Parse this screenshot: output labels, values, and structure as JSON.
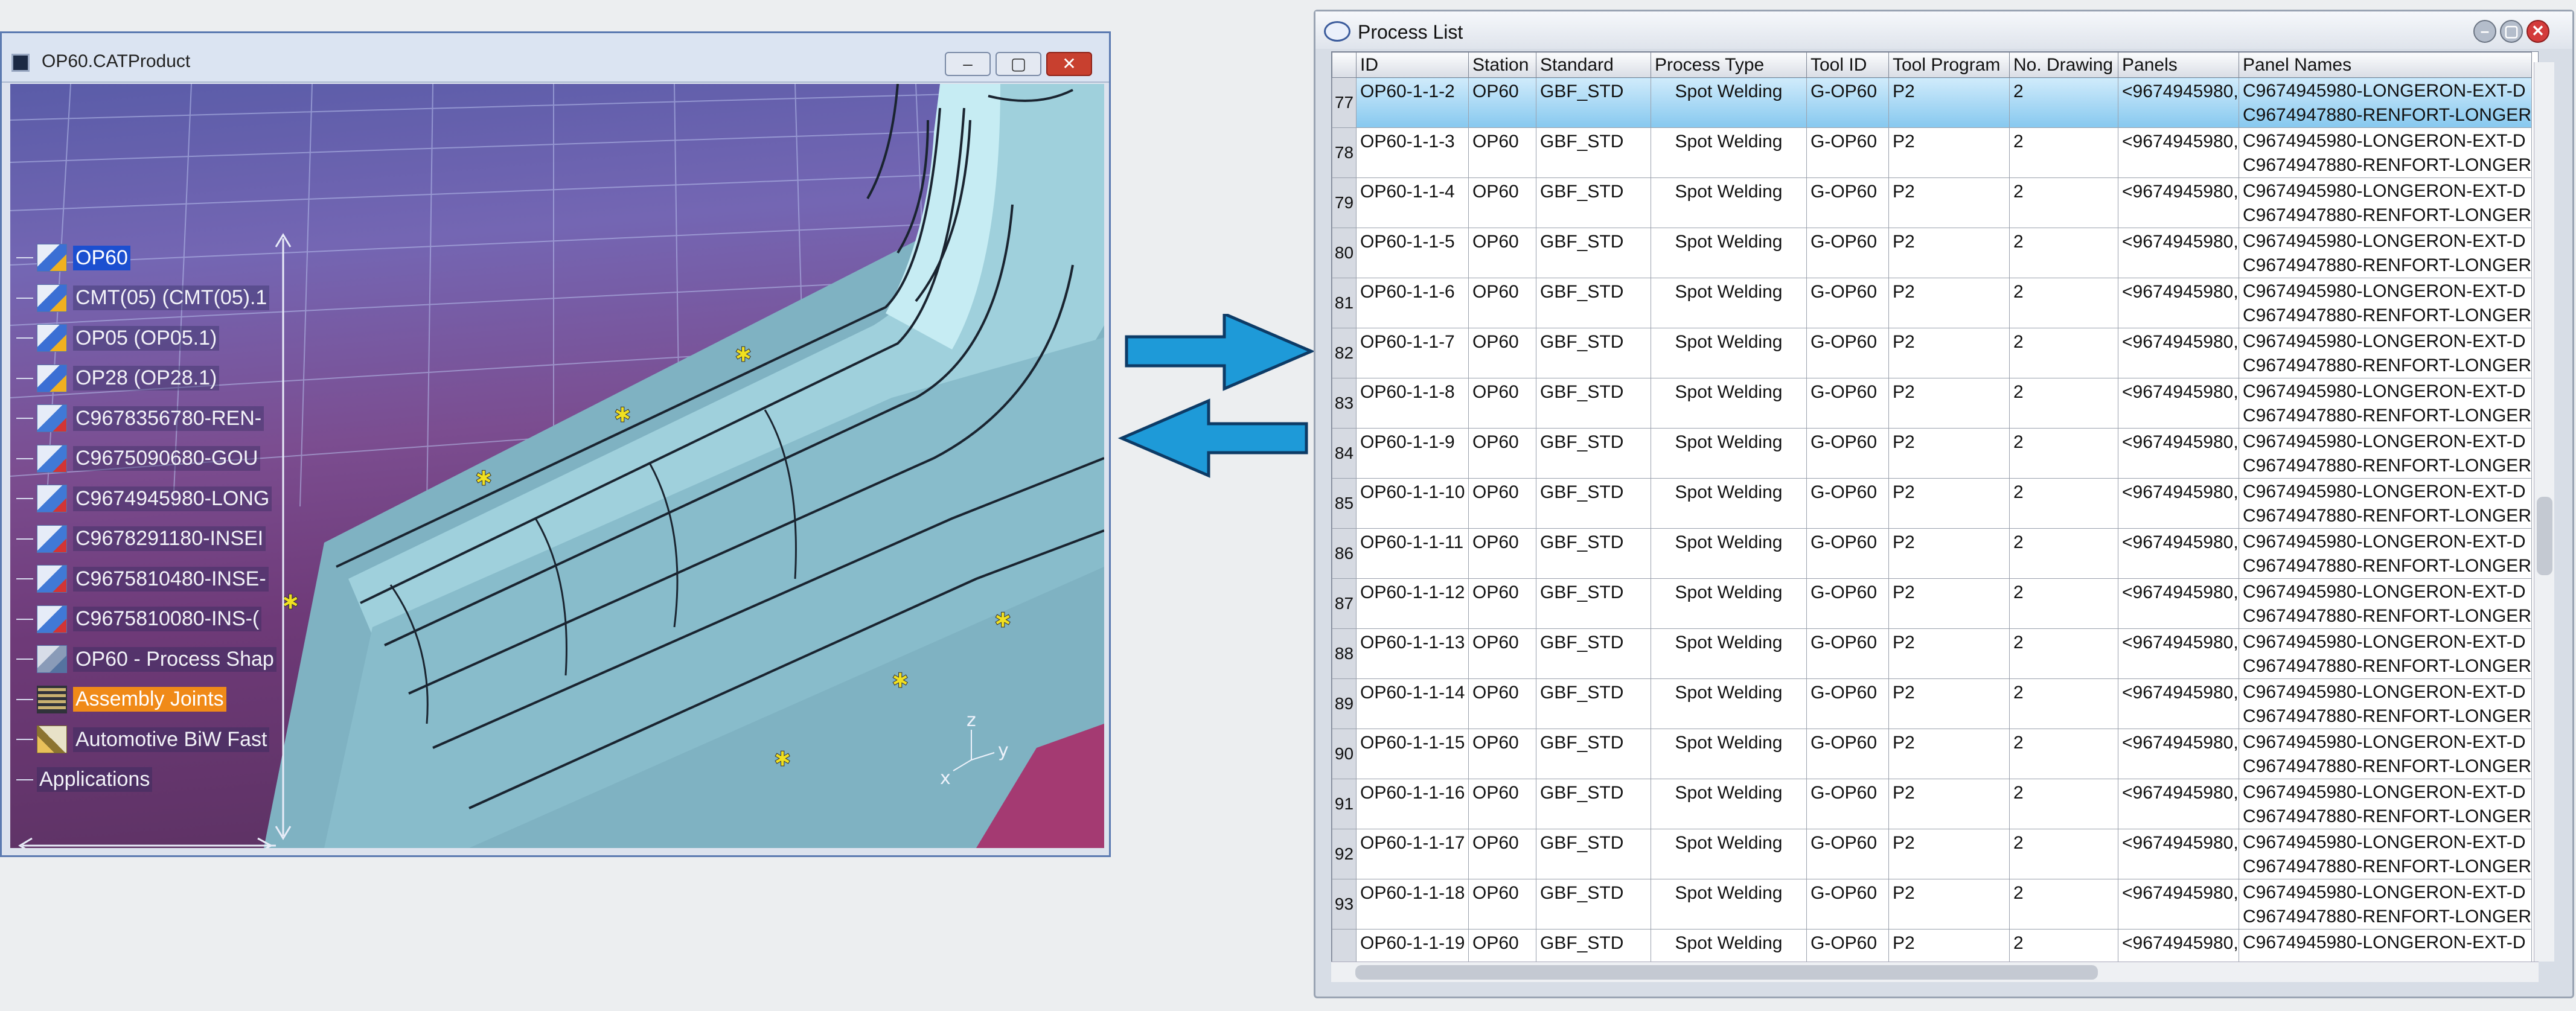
{
  "catia": {
    "title": "OP60.CATProduct",
    "tree": [
      {
        "label": "OP60",
        "icon": "product-icon",
        "state": "selected"
      },
      {
        "label": "CMT(05) (CMT(05).1",
        "icon": "product-icon"
      },
      {
        "label": "OP05 (OP05.1)",
        "icon": "product-icon"
      },
      {
        "label": "OP28 (OP28.1)",
        "icon": "product-icon"
      },
      {
        "label": "C9678356780-REN-",
        "icon": "part-icon"
      },
      {
        "label": "C9675090680-GOU",
        "icon": "part-icon"
      },
      {
        "label": "C9674945980-LONG",
        "icon": "part-icon"
      },
      {
        "label": "C9678291180-INSEI",
        "icon": "part-icon"
      },
      {
        "label": "C9675810480-INSE-",
        "icon": "part-icon"
      },
      {
        "label": "C9675810080-INS-(",
        "icon": "part-icon"
      },
      {
        "label": "OP60 - Process Shap",
        "icon": "process-shape-icon"
      },
      {
        "label": "Assembly Joints",
        "icon": "assembly-joints-icon",
        "state": "highlighted"
      },
      {
        "label": "Automotive BiW Fast",
        "icon": "fastener-icon"
      },
      {
        "label": "Applications",
        "icon": "none"
      }
    ],
    "axis": {
      "x": "x",
      "y": "y",
      "z": "z"
    }
  },
  "plist": {
    "title": "Process List",
    "columns": [
      "ID",
      "Station",
      "Standard",
      "Process Type",
      "Tool ID",
      "Tool Program",
      "No. Drawing",
      "Panels",
      "Panel Names"
    ],
    "rows": [
      {
        "n": "77",
        "id": "OP60-1-1-2",
        "station": "OP60",
        "standard": "GBF_STD",
        "type": "Spot Welding",
        "tool": "G-OP60",
        "prog": "P2",
        "draw": "2",
        "panels": "<9674945980,",
        "pn1": "C9674945980-LONGERON-EXT-D",
        "pn2": "C9674947880-RENFORT-LONGER"
      },
      {
        "n": "78",
        "id": "OP60-1-1-3",
        "station": "OP60",
        "standard": "GBF_STD",
        "type": "Spot Welding",
        "tool": "G-OP60",
        "prog": "P2",
        "draw": "2",
        "panels": "<9674945980,",
        "pn1": "C9674945980-LONGERON-EXT-D",
        "pn2": "C9674947880-RENFORT-LONGER"
      },
      {
        "n": "79",
        "id": "OP60-1-1-4",
        "station": "OP60",
        "standard": "GBF_STD",
        "type": "Spot Welding",
        "tool": "G-OP60",
        "prog": "P2",
        "draw": "2",
        "panels": "<9674945980,",
        "pn1": "C9674945980-LONGERON-EXT-D",
        "pn2": "C9674947880-RENFORT-LONGER"
      },
      {
        "n": "80",
        "id": "OP60-1-1-5",
        "station": "OP60",
        "standard": "GBF_STD",
        "type": "Spot Welding",
        "tool": "G-OP60",
        "prog": "P2",
        "draw": "2",
        "panels": "<9674945980,",
        "pn1": "C9674945980-LONGERON-EXT-D",
        "pn2": "C9674947880-RENFORT-LONGER"
      },
      {
        "n": "81",
        "id": "OP60-1-1-6",
        "station": "OP60",
        "standard": "GBF_STD",
        "type": "Spot Welding",
        "tool": "G-OP60",
        "prog": "P2",
        "draw": "2",
        "panels": "<9674945980,",
        "pn1": "C9674945980-LONGERON-EXT-D",
        "pn2": "C9674947880-RENFORT-LONGER"
      },
      {
        "n": "82",
        "id": "OP60-1-1-7",
        "station": "OP60",
        "standard": "GBF_STD",
        "type": "Spot Welding",
        "tool": "G-OP60",
        "prog": "P2",
        "draw": "2",
        "panels": "<9674945980,",
        "pn1": "C9674945980-LONGERON-EXT-D",
        "pn2": "C9674947880-RENFORT-LONGER"
      },
      {
        "n": "83",
        "id": "OP60-1-1-8",
        "station": "OP60",
        "standard": "GBF_STD",
        "type": "Spot Welding",
        "tool": "G-OP60",
        "prog": "P2",
        "draw": "2",
        "panels": "<9674945980,",
        "pn1": "C9674945980-LONGERON-EXT-D",
        "pn2": "C9674947880-RENFORT-LONGER"
      },
      {
        "n": "84",
        "id": "OP60-1-1-9",
        "station": "OP60",
        "standard": "GBF_STD",
        "type": "Spot Welding",
        "tool": "G-OP60",
        "prog": "P2",
        "draw": "2",
        "panels": "<9674945980,",
        "pn1": "C9674945980-LONGERON-EXT-D",
        "pn2": "C9674947880-RENFORT-LONGER"
      },
      {
        "n": "85",
        "id": "OP60-1-1-10",
        "station": "OP60",
        "standard": "GBF_STD",
        "type": "Spot Welding",
        "tool": "G-OP60",
        "prog": "P2",
        "draw": "2",
        "panels": "<9674945980,",
        "pn1": "C9674945980-LONGERON-EXT-D",
        "pn2": "C9674947880-RENFORT-LONGER"
      },
      {
        "n": "86",
        "id": "OP60-1-1-11",
        "station": "OP60",
        "standard": "GBF_STD",
        "type": "Spot Welding",
        "tool": "G-OP60",
        "prog": "P2",
        "draw": "2",
        "panels": "<9674945980,",
        "pn1": "C9674945980-LONGERON-EXT-D",
        "pn2": "C9674947880-RENFORT-LONGER"
      },
      {
        "n": "87",
        "id": "OP60-1-1-12",
        "station": "OP60",
        "standard": "GBF_STD",
        "type": "Spot Welding",
        "tool": "G-OP60",
        "prog": "P2",
        "draw": "2",
        "panels": "<9674945980,",
        "pn1": "C9674945980-LONGERON-EXT-D",
        "pn2": "C9674947880-RENFORT-LONGER"
      },
      {
        "n": "88",
        "id": "OP60-1-1-13",
        "station": "OP60",
        "standard": "GBF_STD",
        "type": "Spot Welding",
        "tool": "G-OP60",
        "prog": "P2",
        "draw": "2",
        "panels": "<9674945980,",
        "pn1": "C9674945980-LONGERON-EXT-D",
        "pn2": "C9674947880-RENFORT-LONGER"
      },
      {
        "n": "89",
        "id": "OP60-1-1-14",
        "station": "OP60",
        "standard": "GBF_STD",
        "type": "Spot Welding",
        "tool": "G-OP60",
        "prog": "P2",
        "draw": "2",
        "panels": "<9674945980,",
        "pn1": "C9674945980-LONGERON-EXT-D",
        "pn2": "C9674947880-RENFORT-LONGER"
      },
      {
        "n": "90",
        "id": "OP60-1-1-15",
        "station": "OP60",
        "standard": "GBF_STD",
        "type": "Spot Welding",
        "tool": "G-OP60",
        "prog": "P2",
        "draw": "2",
        "panels": "<9674945980,",
        "pn1": "C9674945980-LONGERON-EXT-D",
        "pn2": "C9674947880-RENFORT-LONGER"
      },
      {
        "n": "91",
        "id": "OP60-1-1-16",
        "station": "OP60",
        "standard": "GBF_STD",
        "type": "Spot Welding",
        "tool": "G-OP60",
        "prog": "P2",
        "draw": "2",
        "panels": "<9674945980,",
        "pn1": "C9674945980-LONGERON-EXT-D",
        "pn2": "C9674947880-RENFORT-LONGER"
      },
      {
        "n": "92",
        "id": "OP60-1-1-17",
        "station": "OP60",
        "standard": "GBF_STD",
        "type": "Spot Welding",
        "tool": "G-OP60",
        "prog": "P2",
        "draw": "2",
        "panels": "<9674945980,",
        "pn1": "C9674945980-LONGERON-EXT-D",
        "pn2": "C9674947880-RENFORT-LONGER"
      },
      {
        "n": "93",
        "id": "OP60-1-1-18",
        "station": "OP60",
        "standard": "GBF_STD",
        "type": "Spot Welding",
        "tool": "G-OP60",
        "prog": "P2",
        "draw": "2",
        "panels": "<9674945980,",
        "pn1": "C9674945980-LONGERON-EXT-D",
        "pn2": "C9674947880-RENFORT-LONGER"
      },
      {
        "n": "",
        "id": "OP60-1-1-19",
        "station": "OP60",
        "standard": "GBF_STD",
        "type": "Spot Welding",
        "tool": "G-OP60",
        "prog": "P2",
        "draw": "2",
        "panels": "<9674945980,",
        "pn1": "C9674945980-LONGERON-EXT-D",
        "pn2": ""
      }
    ]
  },
  "colors": {
    "accent_selection": "#1c4fd0",
    "highlight": "#f08a18",
    "arrow": "#1e9ad8",
    "row_selected": "#86c8ef"
  }
}
